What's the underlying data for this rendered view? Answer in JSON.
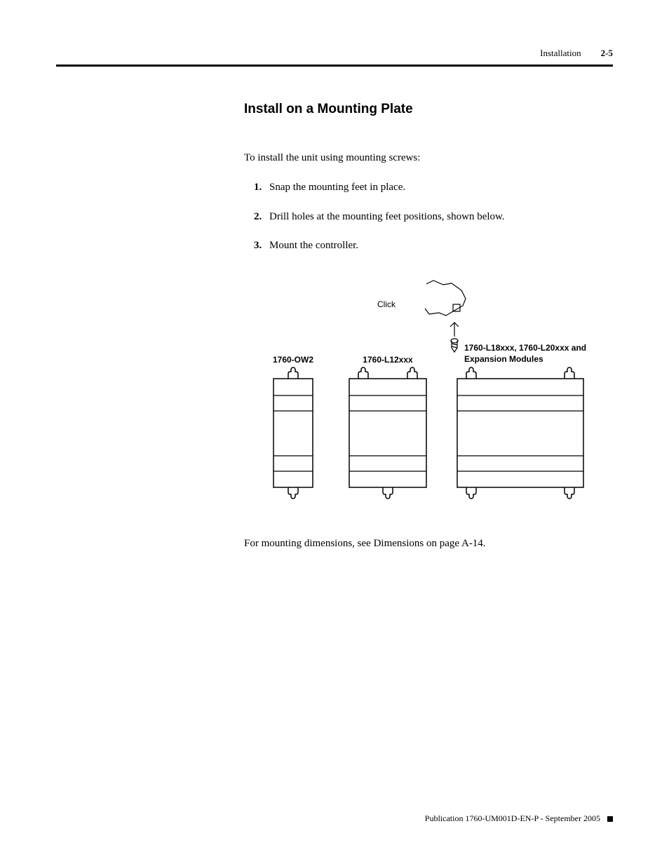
{
  "header": {
    "section": "Installation",
    "page": "2-5"
  },
  "heading": "Install on a Mounting Plate",
  "intro": "To install the unit using mounting screws:",
  "steps": [
    {
      "n": "1.",
      "text": "Snap the mounting feet in place."
    },
    {
      "n": "2.",
      "text": "Drill holes at the mounting feet positions, shown below."
    },
    {
      "n": "3.",
      "text": "Mount the controller."
    }
  ],
  "diagram": {
    "click_label": "Click",
    "col1_label": "1760-OW2",
    "col2_label": "1760-L12xxx",
    "col3_label_line1": "1760-L18xxx, 1760-L20xxx and",
    "col3_label_line2": "Expansion Modules"
  },
  "after_diagram": "For mounting dimensions, see Dimensions on page A-14.",
  "footer": "Publication 1760-UM001D-EN-P - September 2005"
}
